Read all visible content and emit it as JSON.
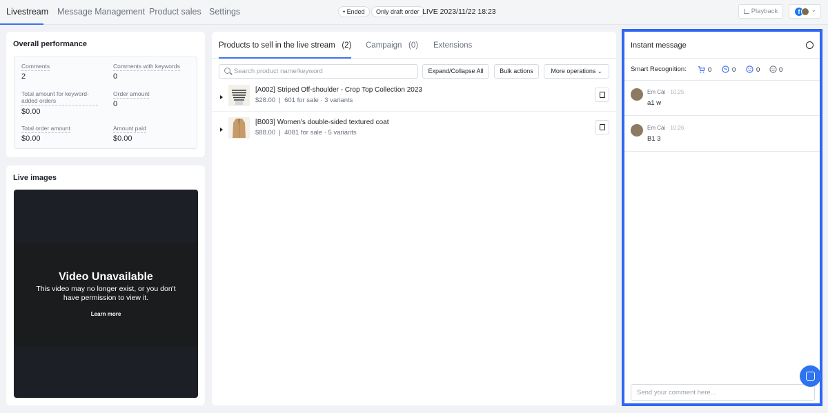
{
  "nav": {
    "tabs": [
      "Livestream",
      "Message Management",
      "Product sales",
      "Settings"
    ],
    "status_ended": "• Ended",
    "status_draft": "Only draft order",
    "live_time": "LIVE 2023/11/22 18:23",
    "playback_label": "Playback"
  },
  "overall": {
    "title": "Overall performance",
    "comments_label": "Comments",
    "comments_value": "2",
    "kw_comments_label": "Comments with keywords",
    "kw_comments_value": "0",
    "kw_amount_label_1": "Total amount for keyword-",
    "kw_amount_label_2": "added orders",
    "kw_amount_value": "$0.00",
    "order_amount_label": "Order amount",
    "order_amount_value": "0",
    "total_order_label": "Total order amount",
    "total_order_value": "$0.00",
    "amount_paid_label": "Amount paid",
    "amount_paid_value": "$0.00"
  },
  "live_images": {
    "title": "Live images",
    "video_title": "Video Unavailable",
    "video_msg": "This video may no longer exist, or you don't have permission to view it.",
    "learn_more": "Learn more"
  },
  "products": {
    "tab_products": "Products to sell in the live stream",
    "tab_products_count": "(2)",
    "tab_campaign": "Campaign",
    "tab_campaign_count": "(0)",
    "tab_extensions": "Extensions",
    "search_placeholder": "Search product name/keyword",
    "expand_label": "Expand/Collapse All",
    "bulk_label": "Bulk actions",
    "more_label": "More operations",
    "items": [
      {
        "name": "[A002] Striped Off-shoulder - Crop Top Collection 2023",
        "price": "$28.00",
        "meta": "601 for sale · 3 variants"
      },
      {
        "name": "[B003] Women's double-sided textured coat",
        "price": "$88.00",
        "meta": "4081 for sale · 5 variants"
      }
    ]
  },
  "instant": {
    "title": "Instant message",
    "smart_label": "Smart Recognition:",
    "counts": [
      "0",
      "0",
      "0",
      "0"
    ],
    "messages": [
      {
        "name": "Em Cài",
        "time": "· 10:25",
        "text": "a1 w"
      },
      {
        "name": "Em Cài",
        "time": "· 10:26",
        "text": "B1 3"
      }
    ],
    "comment_placeholder": "Send your comment here..."
  }
}
